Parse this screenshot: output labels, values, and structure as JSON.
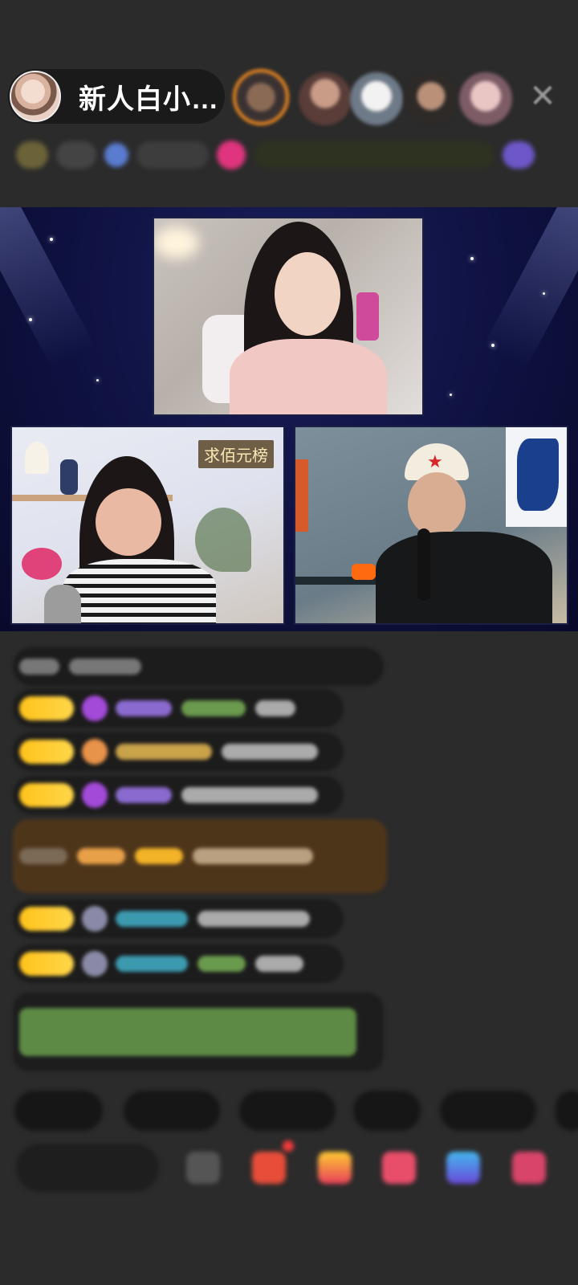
{
  "header": {
    "host_name": "新人白小…",
    "close_glyph": "✕"
  },
  "stage": {
    "guest_tag": "求佰元榜"
  }
}
